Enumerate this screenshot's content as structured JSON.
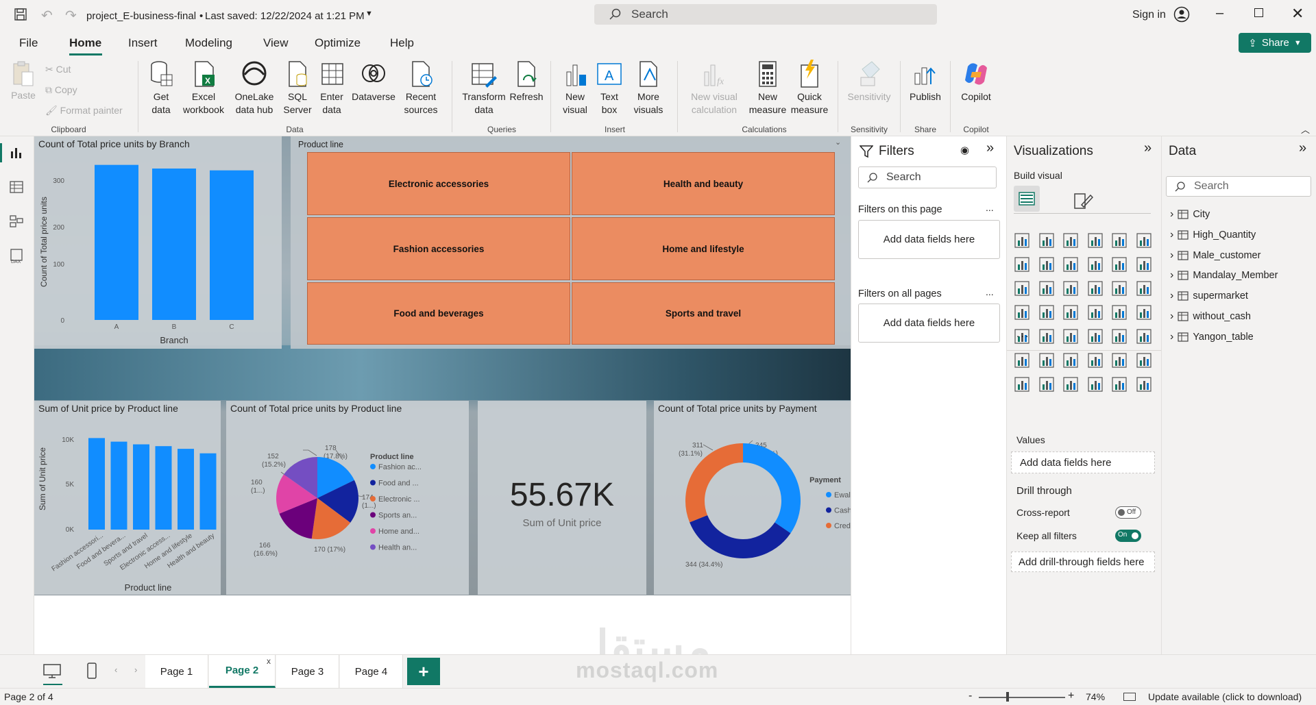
{
  "titlebar": {
    "doc_title": "project_E-business-final",
    "saved": "Last saved: 12/22/2024 at 1:21 PM",
    "search_placeholder": "Search",
    "sign_in": "Sign in"
  },
  "menu": {
    "items": [
      "File",
      "Home",
      "Insert",
      "Modeling",
      "View",
      "Optimize",
      "Help"
    ],
    "active": "Home",
    "share": "Share"
  },
  "ribbon": {
    "clipboard": {
      "paste": "Paste",
      "cut": "Cut",
      "copy": "Copy",
      "format_painter": "Format painter",
      "group": "Clipboard"
    },
    "data": {
      "get_data": "Get data",
      "excel": "Excel workbook",
      "onelake": "OneLake data hub",
      "sql": "SQL Server",
      "enter": "Enter data",
      "dataverse": "Dataverse",
      "recent": "Recent sources",
      "group": "Data"
    },
    "queries": {
      "transform": "Transform data",
      "refresh": "Refresh",
      "group": "Queries"
    },
    "insert": {
      "new_visual": "New visual",
      "text_box": "Text box",
      "more_visuals": "More visuals",
      "group": "Insert"
    },
    "calculations": {
      "new_visual_calc": "New visual calculation",
      "new_measure": "New measure",
      "quick_measure": "Quick measure",
      "group": "Calculations"
    },
    "sensitivity": {
      "label": "Sensitivity",
      "group": "Sensitivity"
    },
    "share": {
      "publish": "Publish",
      "group": "Share"
    },
    "copilot": {
      "label": "Copilot",
      "group": "Copilot"
    }
  },
  "report": {
    "branch_chart": {
      "title": "Count of Total price units by Branch",
      "xlabel": "Branch",
      "ylabel": "Count of Total price units",
      "ticks": [
        "0",
        "100",
        "200",
        "300"
      ]
    },
    "slicer": {
      "title": "Product line",
      "items": [
        "Electronic accessories",
        "Health and beauty",
        "Fashion accessories",
        "Home and lifestyle",
        "Food and beverages",
        "Sports and travel"
      ]
    },
    "unit_price_chart": {
      "title": "Sum of Unit price by Product line",
      "xlabel": "Product line",
      "ylabel": "Sum of Unit price",
      "ticks": [
        "0K",
        "5K",
        "10K"
      ]
    },
    "pie_chart": {
      "title": "Count of Total price units by Product line",
      "legend_title": "Product line",
      "legend": [
        "Fashion ac...",
        "Food and ...",
        "Electronic ...",
        "Sports an...",
        "Home and...",
        "Health an..."
      ],
      "labels": [
        "178",
        "(17.8%)",
        "174",
        "(1...)",
        "170 (17%)",
        "166",
        "(16.6%)",
        "160",
        "(1...)",
        "152",
        "(15.2%)"
      ]
    },
    "card": {
      "value": "55.67K",
      "label": "Sum of Unit price"
    },
    "donut_chart": {
      "title": "Count of Total price units by Payment",
      "legend_title": "Payment",
      "legend": [
        "Ewallet",
        "Cash",
        "Credit card"
      ],
      "labels": [
        "345",
        "(34.5%)",
        "344 (34.4%)",
        "311",
        "(31.1%)"
      ]
    }
  },
  "chart_data": [
    {
      "type": "bar",
      "title": "Count of Total price units by Branch",
      "xlabel": "Branch",
      "ylabel": "Count of Total price units",
      "categories": [
        "A",
        "B",
        "C"
      ],
      "values": [
        340,
        332,
        328
      ],
      "ylim": [
        0,
        350
      ]
    },
    {
      "type": "bar",
      "title": "Sum of Unit price by Product line",
      "xlabel": "Product line",
      "ylabel": "Sum of Unit price",
      "categories": [
        "Fashion accessori...",
        "Food and bevera...",
        "Sports and travel",
        "Electronic access...",
        "Home and lifestyle",
        "Health and beauty"
      ],
      "values": [
        10200,
        9800,
        9500,
        9300,
        9000,
        8500
      ],
      "ylim": [
        0,
        11000
      ]
    },
    {
      "type": "pie",
      "title": "Count of Total price units by Product line",
      "categories": [
        "Fashion accessories",
        "Food and beverages",
        "Electronic accessories",
        "Sports and travel",
        "Home and lifestyle",
        "Health and beauty"
      ],
      "values": [
        178,
        174,
        170,
        166,
        160,
        152
      ]
    },
    {
      "type": "pie",
      "title": "Count of Total price units by Payment",
      "categories": [
        "Ewallet",
        "Cash",
        "Credit card"
      ],
      "values": [
        345,
        344,
        311
      ]
    }
  ],
  "colors": {
    "fashion": "#118dff",
    "food": "#12239e",
    "electronic": "#e66c37",
    "sports": "#6b007b",
    "home": "#e044a7",
    "health": "#744ec2",
    "ewallet": "#118dff",
    "cash": "#12239e",
    "credit": "#e66c37",
    "bar": "#118dff",
    "tile": "#eb8c61"
  },
  "filters": {
    "title": "Filters",
    "search": "Search",
    "on_page": "Filters on this page",
    "on_all": "Filters on all pages",
    "add_fields": "Add data fields here",
    "more": "..."
  },
  "visualizations": {
    "title": "Visualizations",
    "build": "Build visual",
    "values": "Values",
    "add_fields": "Add data fields here",
    "drill_through": "Drill through",
    "cross_report": "Cross-report",
    "cross_report_state": "Off",
    "keep_filters": "Keep all filters",
    "keep_filters_state": "On",
    "add_drill": "Add drill-through fields here",
    "more": "..."
  },
  "data_pane": {
    "title": "Data",
    "search": "Search",
    "tables": [
      "City",
      "High_Quantity",
      "Male_customer",
      "Mandalay_Member",
      "supermarket",
      "without_cash",
      "Yangon_table"
    ]
  },
  "pages": {
    "tabs": [
      "Page 1",
      "Page 2",
      "Page 3",
      "Page 4"
    ],
    "active": "Page 2",
    "close": "x",
    "add": "+"
  },
  "status": {
    "page": "Page 2 of 4",
    "zoom": "74%",
    "update": "Update available (click to download)",
    "minus": "-",
    "plus": "+"
  },
  "watermark": {
    "ar": "مستقل",
    "en": "mostaql.com"
  }
}
